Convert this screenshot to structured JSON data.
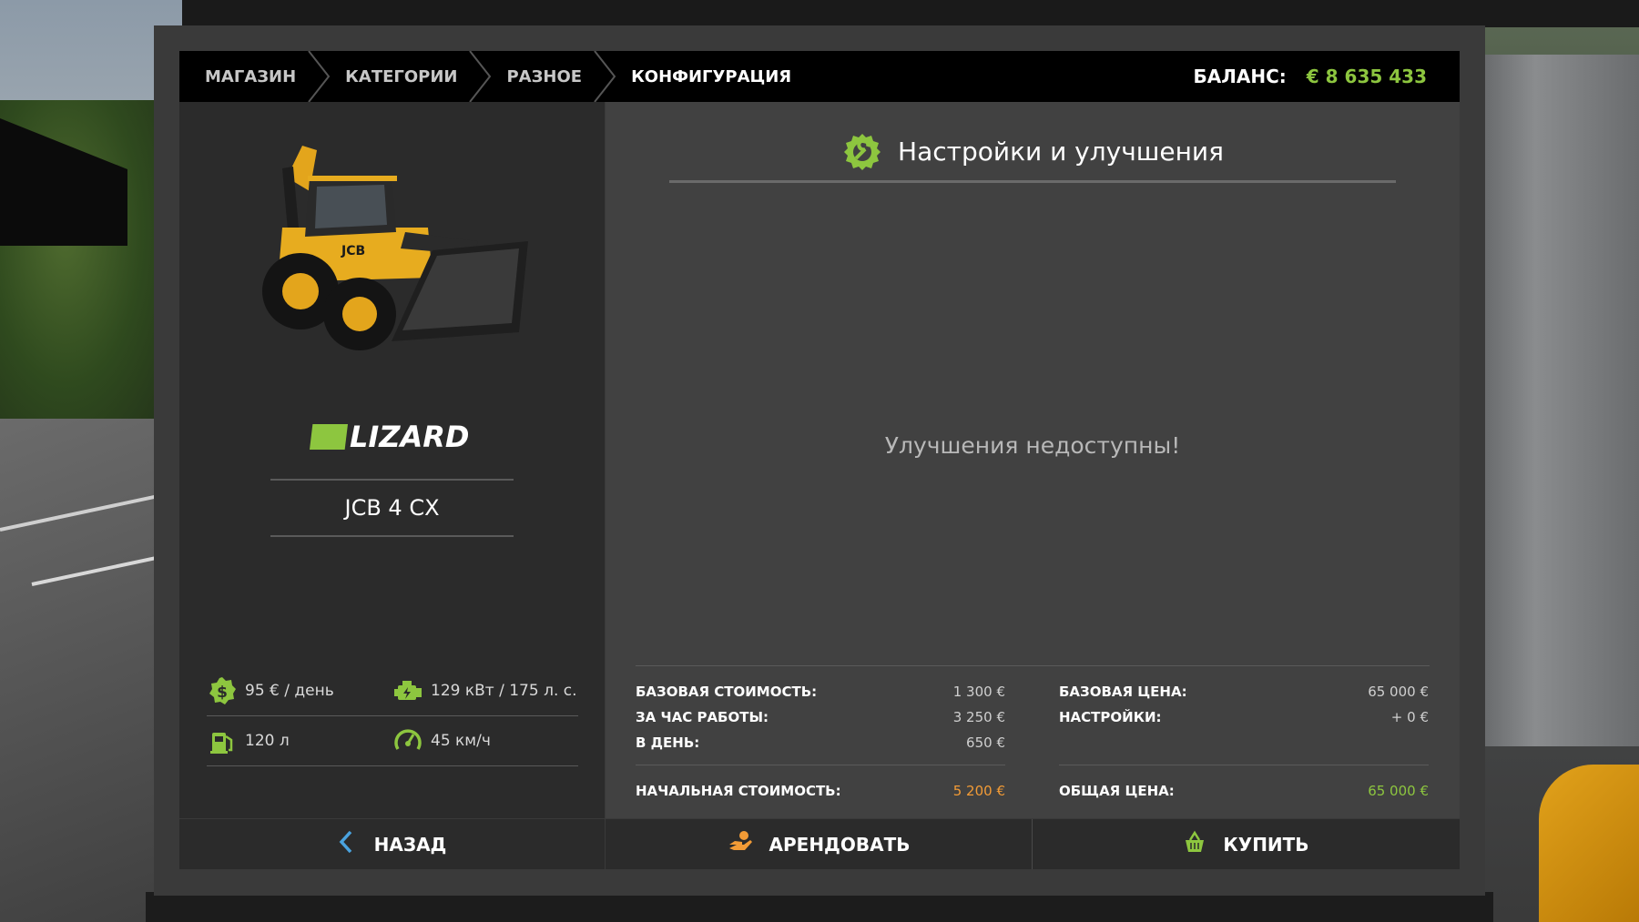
{
  "header": {
    "breadcrumbs": [
      "МАГАЗИН",
      "КАТЕГОРИИ",
      "РАЗНОЕ",
      "КОНФИГУРАЦИЯ"
    ],
    "balance_label": "БАЛАНС:",
    "balance_value": "€ 8 635 433"
  },
  "vehicle": {
    "image": "backhoe-loader-image",
    "brand": "LIZARD",
    "model": "JCB 4 CX",
    "specs": {
      "daily_cost": "95 € / день",
      "power": "129 кВт / 175 л. с.",
      "fuel": "120 л",
      "speed": "45 км/ч"
    }
  },
  "panel": {
    "title": "Настройки и улучшения",
    "empty_message": "Улучшения недоступны!"
  },
  "costs": {
    "lease": {
      "rows": [
        {
          "label": "БАЗОВАЯ СТОИМОСТЬ:",
          "value": "1 300 €"
        },
        {
          "label": "ЗА ЧАС РАБОТЫ:",
          "value": "3 250 €"
        },
        {
          "label": "В ДЕНЬ:",
          "value": "650 €"
        }
      ],
      "total_label": "НАЧАЛЬНАЯ СТОИМОСТЬ:",
      "total_value": "5 200 €"
    },
    "buy": {
      "rows": [
        {
          "label": "БАЗОВАЯ ЦЕНА:",
          "value": "65 000 €"
        },
        {
          "label": "НАСТРОЙКИ:",
          "value": "+ 0 €"
        }
      ],
      "total_label": "ОБЩАЯ ЦЕНА:",
      "total_value": "65 000 €"
    }
  },
  "buttons": {
    "back": "НАЗАД",
    "lease": "АРЕНДОВАТЬ",
    "buy": "КУПИТЬ"
  },
  "colors": {
    "accent_green": "#8dc63f",
    "accent_orange": "#f29b36",
    "back_arrow_blue": "#4aa3df"
  }
}
